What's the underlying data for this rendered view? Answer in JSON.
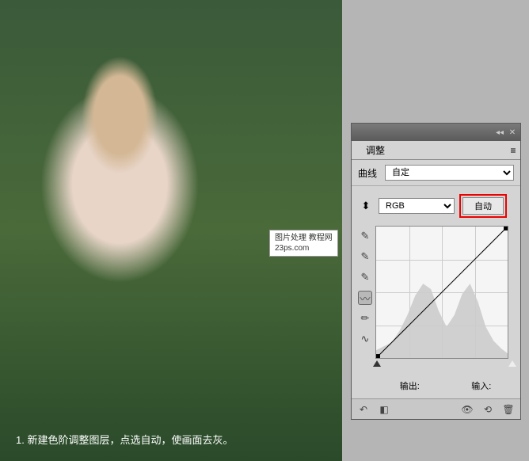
{
  "panel": {
    "tab": "调整",
    "curve_label": "曲线",
    "preset": "自定",
    "channel": "RGB",
    "auto_button": "自动",
    "output_label": "输出:",
    "input_label": "输入:"
  },
  "watermark": {
    "line1": "图片处理",
    "line2": "23ps.com",
    "line3": "教程网"
  },
  "caption": "1. 新建色阶调整图层，点选自动，使画面去灰。",
  "chart_data": {
    "type": "line",
    "title": "Curves Adjustment - RGB",
    "xlabel": "Input",
    "ylabel": "Output",
    "xlim": [
      0,
      255
    ],
    "ylim": [
      0,
      255
    ],
    "series": [
      {
        "name": "diagonal",
        "x": [
          0,
          255
        ],
        "values": [
          0,
          255
        ]
      }
    ],
    "histogram_approx": [
      10,
      15,
      20,
      35,
      55,
      80,
      95,
      88,
      60,
      40,
      55,
      82,
      95,
      72,
      40,
      22,
      12,
      6
    ]
  },
  "icons": {
    "collapse": "◂◂",
    "close": "✕",
    "menu": "≡",
    "point_tool": "⬍",
    "eyedropper": "✎",
    "eyedropper_plus": "✎",
    "eyedropper_minus": "✎",
    "curve_tool": "〰",
    "pencil": "✏",
    "smooth": "∿",
    "back": "↶",
    "layers": "◧",
    "eye": "👁",
    "reset": "⟲",
    "trash": "🗑"
  }
}
